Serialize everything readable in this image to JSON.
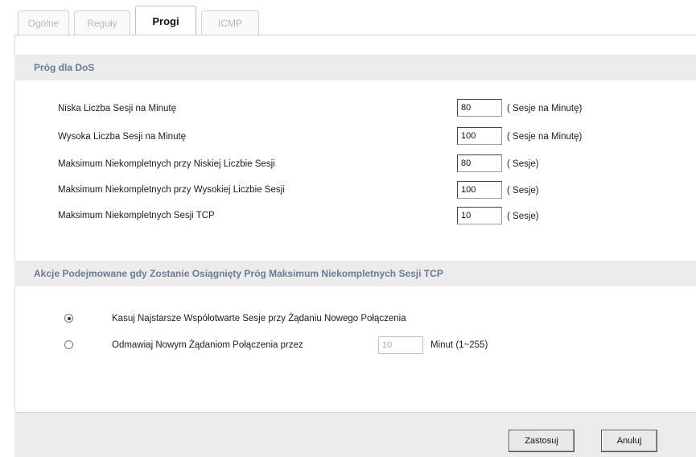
{
  "tabs": [
    {
      "label": "Ogólne",
      "active": false
    },
    {
      "label": "Reguły",
      "active": false
    },
    {
      "label": "Progi",
      "active": true
    },
    {
      "label": "ICMP",
      "active": false
    }
  ],
  "dos_section": {
    "title": "Próg dla DoS",
    "rows": [
      {
        "label": "Niska Liczba Sesji na Minutę",
        "value": "80",
        "unit": "( Sesje na Minutę)"
      },
      {
        "label": "Wysoka Liczba Sesji na Minutę",
        "value": "100",
        "unit": "( Sesje na Minutę)"
      },
      {
        "label": "Maksimum Niekompletnych przy Niskiej Liczbie Sesji",
        "value": "80",
        "unit": "( Sesje)"
      },
      {
        "label": "Maksimum Niekompletnych przy Wysokiej Liczbie Sesji",
        "value": "100",
        "unit": "( Sesje)"
      },
      {
        "label": "Maksimum Niekompletnych Sesji TCP",
        "value": "10",
        "unit": "( Sesje)"
      }
    ]
  },
  "action_section": {
    "title": "Akcje Podejmowane gdy Zostanie Osiągnięty Próg Maksimum Niekompletnych Sesji TCP",
    "options": [
      {
        "label": "Kasuj Najstarsze Współotwarte Sesje przy Żądaniu Nowego Połączenia",
        "checked": true
      },
      {
        "label": "Odmawiaj Nowym Żądaniom Połączenia przez",
        "checked": false
      }
    ],
    "block_minutes_value": "10",
    "block_minutes_unit": "Minut (1~255)"
  },
  "buttons": {
    "apply": "Zastosuj",
    "cancel": "Anuluj"
  }
}
